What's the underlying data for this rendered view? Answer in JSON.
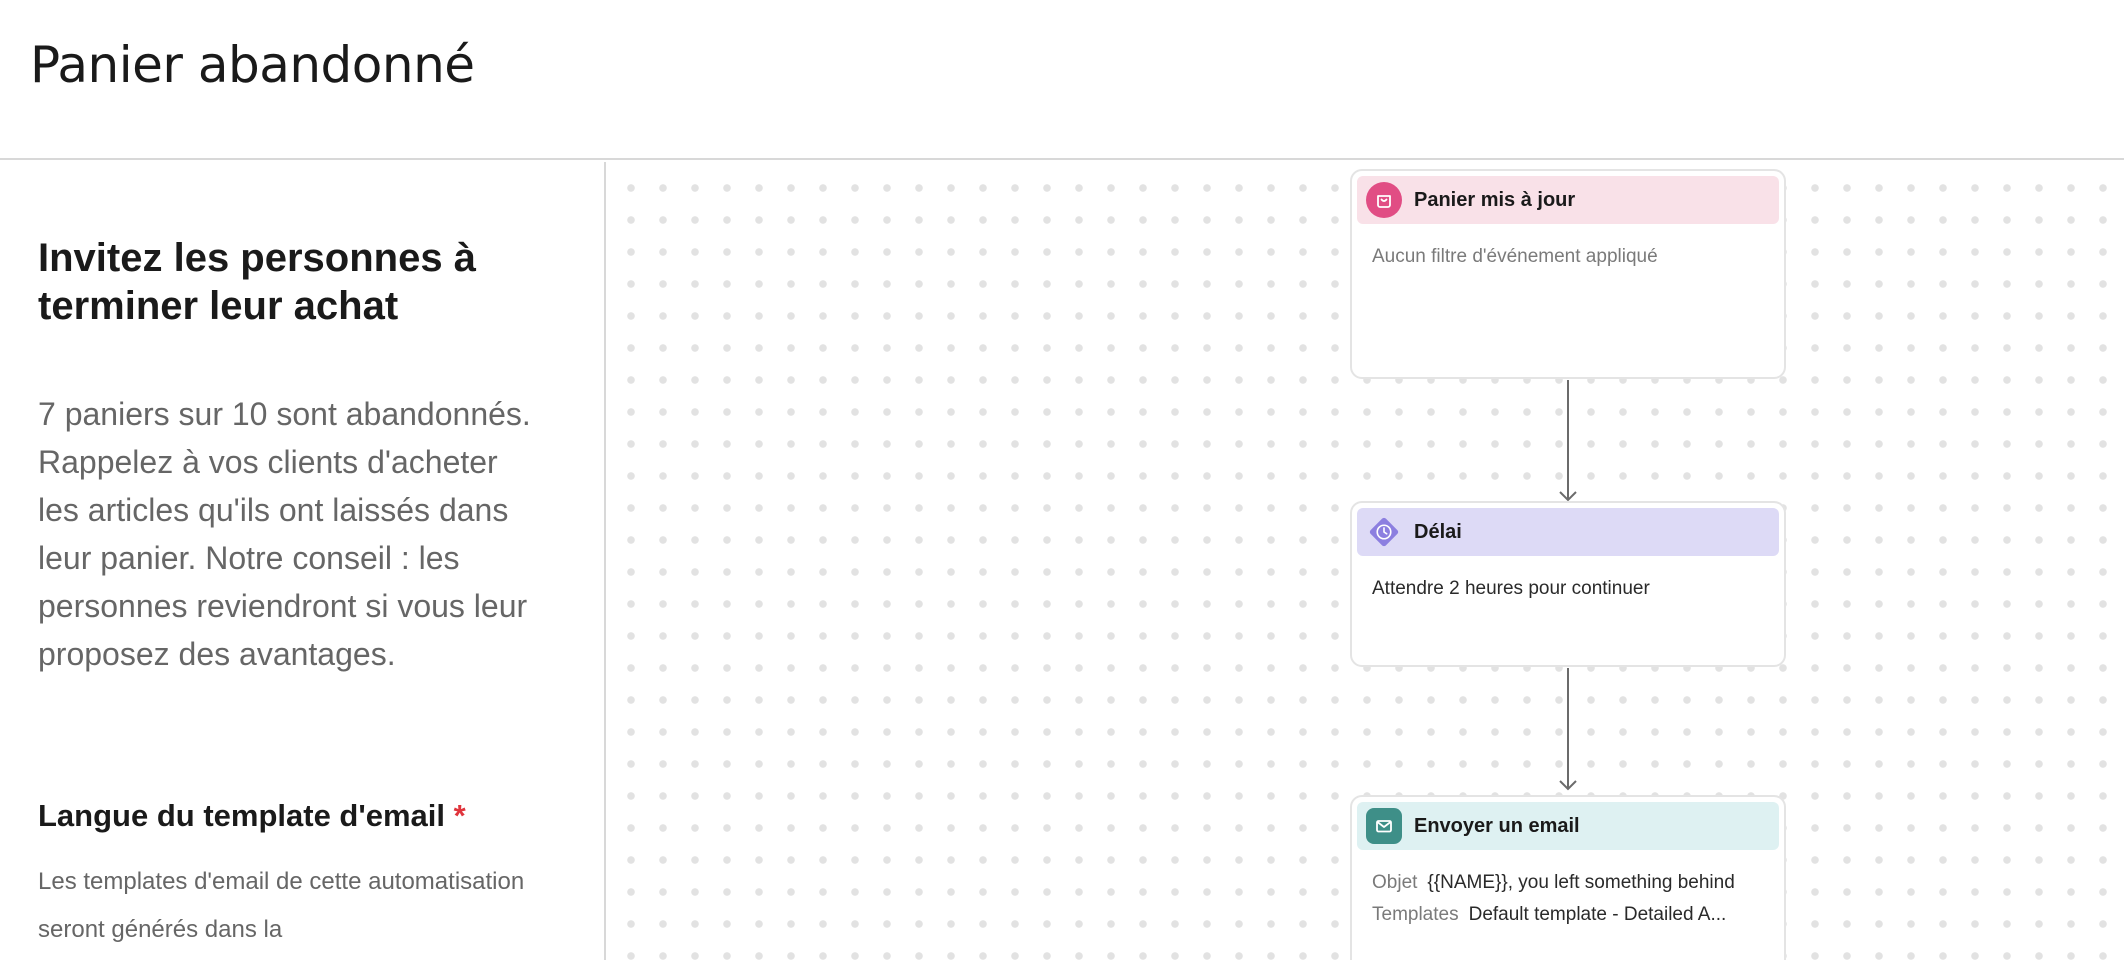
{
  "page": {
    "title": "Panier abandonné"
  },
  "intro": {
    "heading": "Invitez les personnes à terminer leur achat",
    "description": "7 paniers sur 10 sont abandonnés. Rappelez à vos clients d'acheter les articles qu'ils ont laissés dans leur panier. Notre conseil : les personnes reviendront si vous leur proposez des avantages."
  },
  "language_section": {
    "heading": "Langue du template d'email",
    "required_marker": "*",
    "description": "Les templates d'email de cette automatisation seront générés dans la"
  },
  "workflow": {
    "trigger": {
      "title": "Panier mis à jour",
      "body": "Aucun filtre d'événement appliqué",
      "icon": "cart-icon",
      "accent": "#e14d84",
      "header_bg": "#f9e1e8"
    },
    "delay": {
      "title": "Délai",
      "body": "Attendre 2 heures pour continuer",
      "icon": "clock-icon",
      "accent": "#8c7fe0",
      "header_bg": "#dddaf6"
    },
    "email": {
      "title": "Envoyer un email",
      "subject_label": "Objet",
      "subject_value": "{{NAME}}, you left something behind",
      "template_label": "Templates",
      "template_value": "Default template - Detailed A...",
      "icon": "mail-icon",
      "accent": "#3e8f88",
      "header_bg": "#def1f2"
    }
  }
}
